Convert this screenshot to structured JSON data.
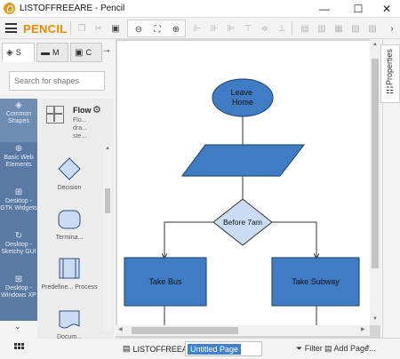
{
  "window": {
    "title": "LISTOFFREEARE - Pencil",
    "minimize_glyph": "—",
    "maximize_glyph": "☐",
    "close_glyph": "✕",
    "icon": "pencil-app-icon"
  },
  "toolbar": {
    "brand": "PENCIL",
    "menu_icon": "hamburger-menu-icon"
  },
  "left_panel": {
    "tabs": [
      {
        "label": "S",
        "icon": "layers-icon"
      },
      {
        "label": "M",
        "icon": "briefcase-icon"
      },
      {
        "label": "C",
        "icon": "image-icon"
      }
    ],
    "search_placeholder": "Search for shapes",
    "categories": [
      {
        "label": "Common Shapes",
        "icon": "layers-icon"
      },
      {
        "label": "Basic Web Elements",
        "icon": "globe-icon"
      },
      {
        "label": "Desktop - GTK Widgets",
        "icon": "grid-icon"
      },
      {
        "label": "Desktop - Sketchy GUI",
        "icon": "sketch-icon"
      },
      {
        "label": "Desktop - Windows XP",
        "icon": "grid-icon"
      }
    ],
    "collection": {
      "title": "Flow",
      "description": "Flo... dra... ste..."
    },
    "shapes": [
      {
        "label": "Decision"
      },
      {
        "label": "Termina..."
      },
      {
        "label": "Predefine... Process"
      },
      {
        "label": "Docum..."
      }
    ]
  },
  "canvas": {
    "nodes": {
      "leave_home": "Leave Home",
      "before_7am": "Before 7am",
      "take_bus": "Take Bus",
      "take_subway": "Take Subway"
    },
    "colors": {
      "shape_fill": "#3f7cc4",
      "shape_stroke": "#2a4f7e",
      "decision_fill": "#c9dcf3"
    }
  },
  "properties": {
    "label": "Properties"
  },
  "bottom_bar": {
    "document_name": "LISTOFFREEARE",
    "page_name": "Untitled Page",
    "filter_label": "Filter",
    "add_page_label": "Add Page..."
  }
}
